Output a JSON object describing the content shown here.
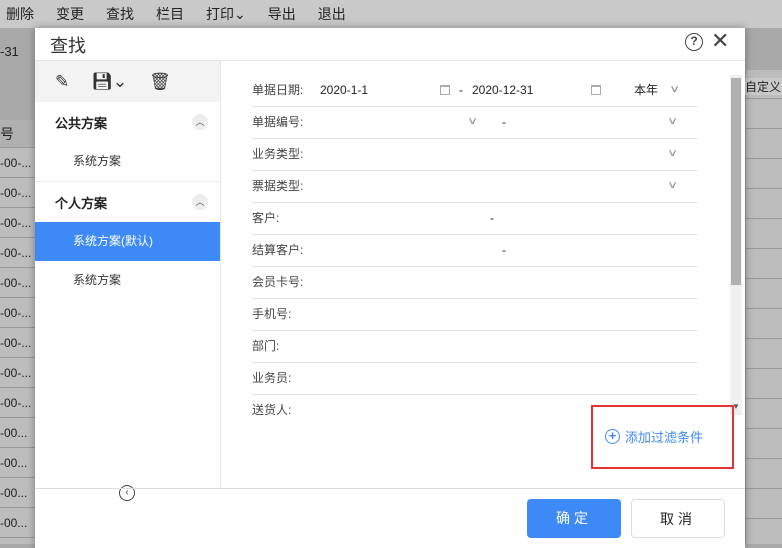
{
  "menu": [
    "删除",
    "变更",
    "查找",
    "栏目",
    "打印⌄",
    "导出",
    "退出"
  ],
  "background": {
    "date_fragment": "-31",
    "column_header": "号",
    "cells": [
      "-00-...",
      "-00-...",
      "-00-...",
      "-00-...",
      "-00-...",
      "-00-...",
      "-00-...",
      "-00-...",
      "-00-...",
      "-00...",
      "-00...",
      "-00...",
      "-00..."
    ],
    "customize": "自定义"
  },
  "dialog": {
    "title": "查找",
    "help": "?",
    "close": "✕"
  },
  "left": {
    "public_group": "公共方案",
    "public_items": [
      "系统方案"
    ],
    "personal_group": "个人方案",
    "personal_items": [
      "系统方案(默认)",
      "系统方案"
    ]
  },
  "form": {
    "date_label": "单据日期:",
    "date_from": "2020-1-1",
    "date_to": "2020-12-31",
    "date_range": "本年",
    "dash": "-",
    "fields": [
      "单据编号:",
      "业务类型:",
      "票据类型:",
      "客户:",
      "结算客户:",
      "会员卡号:",
      "手机号:",
      "部门:",
      "业务员:",
      "送货人:"
    ]
  },
  "add_filter": "添加过滤条件",
  "buttons": {
    "ok": "确定",
    "cancel": "取消"
  },
  "colors": {
    "accent": "#3d8af7",
    "highlight_box": "#e53333"
  }
}
